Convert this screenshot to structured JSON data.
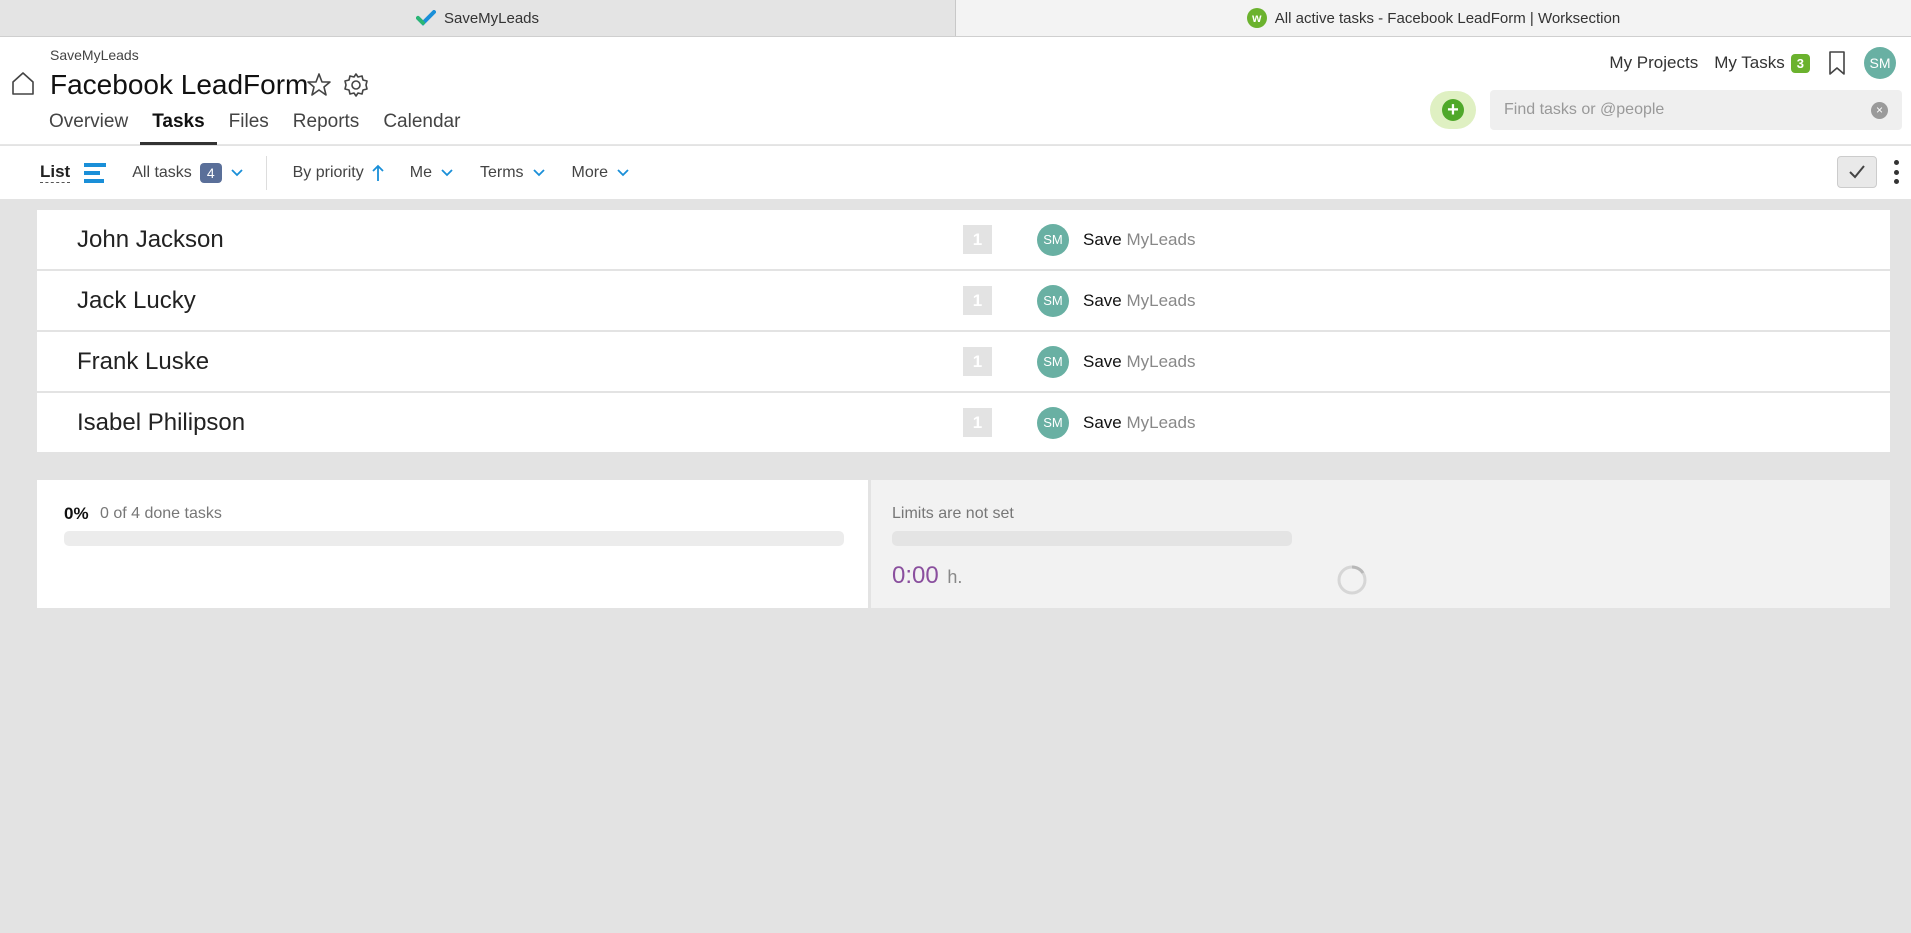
{
  "browser_tabs": [
    {
      "title": "SaveMyLeads",
      "icon": "savemyleads-check-icon"
    },
    {
      "title": "All active tasks - Facebook LeadForm | Worksection",
      "icon": "worksection-icon"
    }
  ],
  "header": {
    "breadcrumb": "SaveMyLeads",
    "project_title": "Facebook LeadForm",
    "nav": [
      {
        "label": "Overview"
      },
      {
        "label": "Tasks",
        "active": true
      },
      {
        "label": "Files"
      },
      {
        "label": "Reports"
      },
      {
        "label": "Calendar"
      }
    ],
    "my_projects": "My Projects",
    "my_tasks": "My Tasks",
    "my_tasks_count": "3",
    "user_initials": "SM",
    "search_placeholder": "Find tasks or @people",
    "add_icon": "+"
  },
  "toolbar": {
    "view": "List",
    "all_tasks": "All tasks",
    "all_tasks_count": "4",
    "sort": "By priority",
    "assignee_filter": "Me",
    "terms": "Terms",
    "more": "More"
  },
  "tasks": [
    {
      "name": "John Jackson",
      "priority": "1",
      "assignee_initials": "SM",
      "assignee_first": "Save",
      "assignee_last": "MyLeads"
    },
    {
      "name": "Jack Lucky",
      "priority": "1",
      "assignee_initials": "SM",
      "assignee_first": "Save",
      "assignee_last": "MyLeads"
    },
    {
      "name": "Frank Luske",
      "priority": "1",
      "assignee_initials": "SM",
      "assignee_first": "Save",
      "assignee_last": "MyLeads"
    },
    {
      "name": "Isabel Philipson",
      "priority": "1",
      "assignee_initials": "SM",
      "assignee_first": "Save",
      "assignee_last": "MyLeads"
    }
  ],
  "stats": {
    "percent": "0%",
    "progress_fraction": 0,
    "done_text": "0 of 4 done tasks",
    "limits_text": "Limits are not set",
    "time_value": "0:00",
    "time_unit": "h."
  },
  "colors": {
    "accent_green": "#6bb22e",
    "count_badge": "#5a6f99",
    "avatar": "#69b0a3",
    "time": "#8a4f9e",
    "list_icon": "#1a8fd8"
  }
}
